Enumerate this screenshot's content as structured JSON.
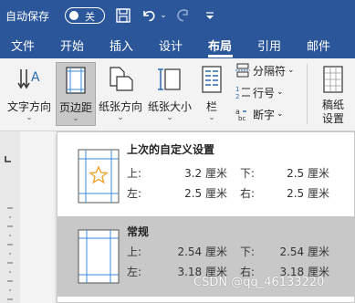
{
  "titlebar": {
    "autosave_label": "自动保存",
    "toggle_state": "关"
  },
  "tabs": [
    "文件",
    "开始",
    "插入",
    "设计",
    "布局",
    "引用",
    "邮件"
  ],
  "active_tab": "布局",
  "ribbon": {
    "text_direction": "文字方向",
    "margins": "页边距",
    "orientation": "纸张方向",
    "size": "纸张大小",
    "columns": "栏",
    "breaks": "分隔符",
    "line_numbers": "行号",
    "hyphenation": "断字",
    "manuscript": "稿纸设置"
  },
  "margins_menu": {
    "options": [
      {
        "name": "上次的自定义设置",
        "top_label": "上:",
        "top_value": "3.2 厘米",
        "bottom_label": "下:",
        "bottom_value": "2.5 厘米",
        "left_label": "左:",
        "left_value": "2.5 厘米",
        "right_label": "右:",
        "right_value": "2.5 厘米"
      },
      {
        "name": "常规",
        "top_label": "上:",
        "top_value": "2.54 厘米",
        "bottom_label": "下:",
        "bottom_value": "2.54 厘米",
        "left_label": "左:",
        "left_value": "3.18 厘米",
        "right_label": "右:",
        "right_value": "3.18 厘米"
      }
    ]
  },
  "watermark": "CSDN @qq_46133220",
  "colors": {
    "accent": "#2b579a",
    "ribbon_bg": "#f3f3f3",
    "selected": "#c8c8c8",
    "margin_line": "#3a8ad8",
    "star": "#f0a020"
  }
}
